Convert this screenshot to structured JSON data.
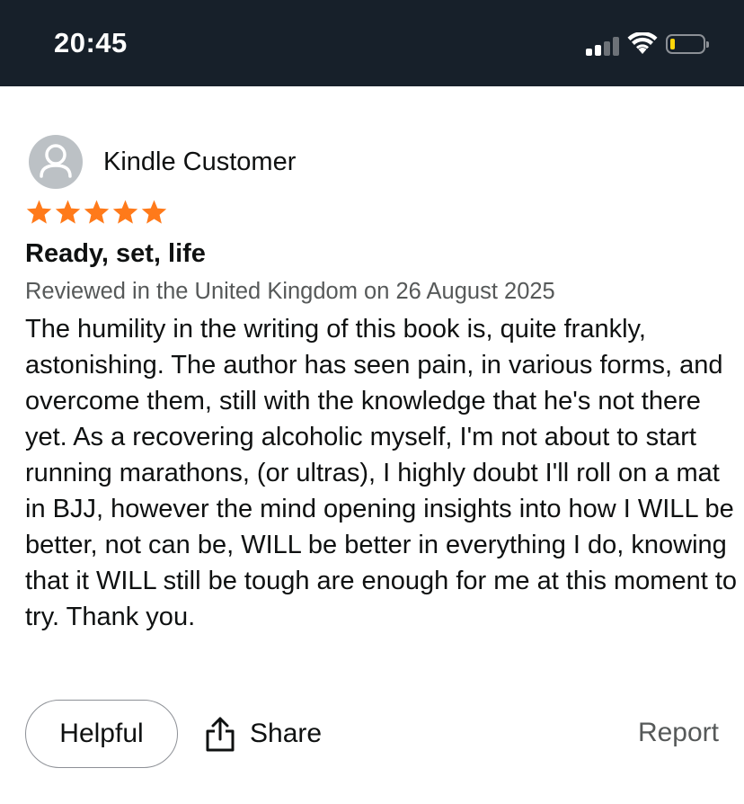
{
  "status_bar": {
    "time": "20:45",
    "icons": [
      "cellular-signal-icon",
      "wifi-icon",
      "battery-icon"
    ],
    "signal_bars_active": 2,
    "signal_bars_total": 4,
    "battery_level": 0.15,
    "battery_color": "#ffd60a"
  },
  "review": {
    "reviewer_name": "Kindle Customer",
    "avatar_icon": "user-avatar-icon",
    "rating": 5,
    "rating_max": 5,
    "star_color": "#ff7a1a",
    "title": "Ready, set, life",
    "meta": "Reviewed in the United Kingdom on 26 August 2025",
    "body": "The humility in the writing of this book is, quite frankly, astonishing. The author has seen pain, in various forms, and overcome them, still with the knowledge that he's not there yet. As a recovering alcoholic myself, I'm not about to start running marathons, (or ultras), I highly doubt I'll roll on a mat in BJJ, however the mind opening insights into how I WILL be better, not can be, WILL be better in everything I do, knowing that it WILL still be tough are enough for me at this moment to try. Thank you."
  },
  "actions": {
    "helpful_label": "Helpful",
    "share_label": "Share",
    "share_icon": "share-icon",
    "report_label": "Report"
  }
}
